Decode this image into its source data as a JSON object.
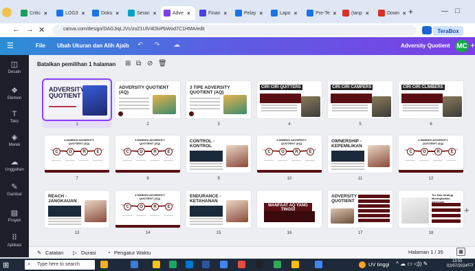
{
  "browser": {
    "tabs": [
      {
        "label": "Critic",
        "color": "#1a9e5b",
        "active": false
      },
      {
        "label": "LOG3",
        "color": "#1a73e8",
        "active": false
      },
      {
        "label": "Doku",
        "color": "#1a73e8",
        "active": false
      },
      {
        "label": "Seran",
        "color": "#00a3c4",
        "active": false
      },
      {
        "label": "Adve",
        "color": "#7b3fe4",
        "active": true
      },
      {
        "label": "Finan",
        "color": "#4a3fe4",
        "active": false
      },
      {
        "label": "Pelay",
        "color": "#1a73e8",
        "active": false
      },
      {
        "label": "Lapo",
        "color": "#1a73e8",
        "active": false
      },
      {
        "label": "Pre-Te",
        "color": "#1a73e8",
        "active": false
      },
      {
        "label": "(tanp",
        "color": "#d93025",
        "active": false
      },
      {
        "label": "Down",
        "color": "#d93025",
        "active": false
      }
    ],
    "new_tab": "+",
    "minimize": "—",
    "maximize": "□",
    "back": "←",
    "forward": "→",
    "close_nav": "✕",
    "url": "canva.com/design/DAGJiqLJVc/zoZ1UlV4DloPbWod7C1HMA/edit",
    "terabox_label": "TeraBox"
  },
  "canva": {
    "menu_icon": "☰",
    "file_label": "File",
    "resize_label": "Ubah Ukuran dan Alih Ajaib",
    "undo_icon": "↶",
    "redo_icon": "↷",
    "cloud_icon": "☁",
    "doc_title": "Adversity Quotient",
    "avatar_initials": "MC",
    "add_icon": "+"
  },
  "rail": [
    {
      "icon": "◫",
      "label": "Desain"
    },
    {
      "icon": "❖",
      "label": "Elemen"
    },
    {
      "icon": "T",
      "label": "Teks"
    },
    {
      "icon": "◈",
      "label": "Merek"
    },
    {
      "icon": "☁",
      "label": "Unggahan"
    },
    {
      "icon": "✎",
      "label": "Gambar"
    },
    {
      "icon": "▤",
      "label": "Proyek"
    },
    {
      "icon": "⠿",
      "label": "Aplikasi"
    }
  ],
  "toolbar": {
    "selection_text": "Batalkan pemilihan 1 halaman",
    "add_page_icon": "⊞",
    "duplicate_icon": "⧉",
    "hide_icon": "⊘",
    "delete_icon": "🗑"
  },
  "slides": [
    {
      "num": "1",
      "title": "ADVERSITY QUOTIENT",
      "kind": "cover",
      "selected": true
    },
    {
      "num": "2",
      "title": "ADVERSITY QUOTIENT (AQ)",
      "kind": "text-img",
      "selected": false
    },
    {
      "num": "3",
      "title": "3 TIPE ADVERSITY QUOTIENT (AQ)",
      "kind": "text-img",
      "selected": false
    },
    {
      "num": "4",
      "title": "CIRI CIRI QUITTERS",
      "kind": "banner-dark",
      "selected": false
    },
    {
      "num": "5",
      "title": "CIRI CIRI CAMPERS",
      "kind": "banner-dark",
      "selected": false
    },
    {
      "num": "6",
      "title": "CIRI CIRI CLIMBERS",
      "kind": "banner-dark",
      "selected": false
    },
    {
      "num": "7",
      "title": "4 DIMENSI ADVERSITY QUOTIENT (AQ)",
      "kind": "core",
      "selected": false
    },
    {
      "num": "8",
      "title": "4 DIMENSI ADVERSITY QUOTIENT (AQ)",
      "kind": "core",
      "selected": false
    },
    {
      "num": "9",
      "title": "CONTROL - KONTROL",
      "kind": "text-box",
      "selected": false
    },
    {
      "num": "10",
      "title": "4 DIMENSI ADVERSITY QUOTIENT (AQ)",
      "kind": "core",
      "selected": false
    },
    {
      "num": "11",
      "title": "OWNERSHIP - KEPEMILIKAN",
      "kind": "text-box",
      "selected": false
    },
    {
      "num": "12",
      "title": "4 DIMENSI ADVERSITY QUOTIENT (AQ)",
      "kind": "core",
      "selected": false
    },
    {
      "num": "13",
      "title": "REACH - JANGKAUAN",
      "kind": "text-box",
      "selected": false
    },
    {
      "num": "14",
      "title": "4 DIMENSI ADVERSITY QUOTIENT (AQ)",
      "kind": "core",
      "selected": false
    },
    {
      "num": "15",
      "title": "ENDURANCE - KETAHANAN",
      "kind": "text-box",
      "selected": false
    },
    {
      "num": "16",
      "title": "MANFAAT AQ YANG TINGGI",
      "kind": "bar-box",
      "selected": false
    },
    {
      "num": "17",
      "title": "ADVERSITY QUOTIENT",
      "kind": "list",
      "selected": false
    },
    {
      "num": "18",
      "title": "Tes Dan Strategi Meningkatkan Adversity",
      "kind": "list-right",
      "selected": false
    }
  ],
  "core_letters": [
    "C",
    "O",
    "R",
    "E"
  ],
  "footer": {
    "notes_icon": "✎",
    "notes_label": "Catatan",
    "duration_icon": "▷",
    "duration_label": "Durasi",
    "timer_icon": "◔",
    "timer_label": "Pengatur Waktu",
    "page_count": "Halaman 1 / 35",
    "grid_icon": "▦",
    "scroll_add": "+"
  },
  "taskbar": {
    "start_icon": "⊞",
    "search_icon": "⌕",
    "search_placeholder": "Type here to search",
    "weather": "UV tinggi",
    "tray": "^ ☁ ▭ ◁)) ✎",
    "time": "13:55",
    "date": "02/07/2024",
    "notif_icon": "▭"
  },
  "colors": {
    "accent": "#8b3dff",
    "slide_dark": "#5a0f14",
    "canva_gradient_start": "#2b8fd6",
    "canva_gradient_end": "#7b3fe4"
  }
}
